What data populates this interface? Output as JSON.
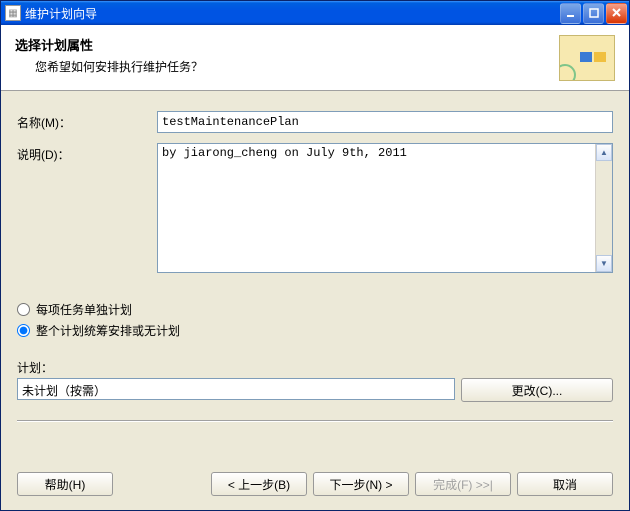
{
  "window": {
    "title": "维护计划向导"
  },
  "header": {
    "title": "选择计划属性",
    "subtitle": "您希望如何安排执行维护任务？"
  },
  "form": {
    "name_label": "名称(M)：",
    "name_value": "testMaintenancePlan",
    "desc_label": "说明(D)：",
    "desc_value": "by jiarong_cheng on July 9th, 2011"
  },
  "radios": {
    "opt1": "每项任务单独计划",
    "opt2": "整个计划统筹安排或无计划",
    "selected": "opt2"
  },
  "plan": {
    "label": "计划：",
    "value": "未计划（按需）",
    "change_btn": "更改(C)..."
  },
  "footer": {
    "help": "帮助(H)",
    "back": "< 上一步(B)",
    "next": "下一步(N) >",
    "finish": "完成(F) >>|",
    "cancel": "取消"
  }
}
